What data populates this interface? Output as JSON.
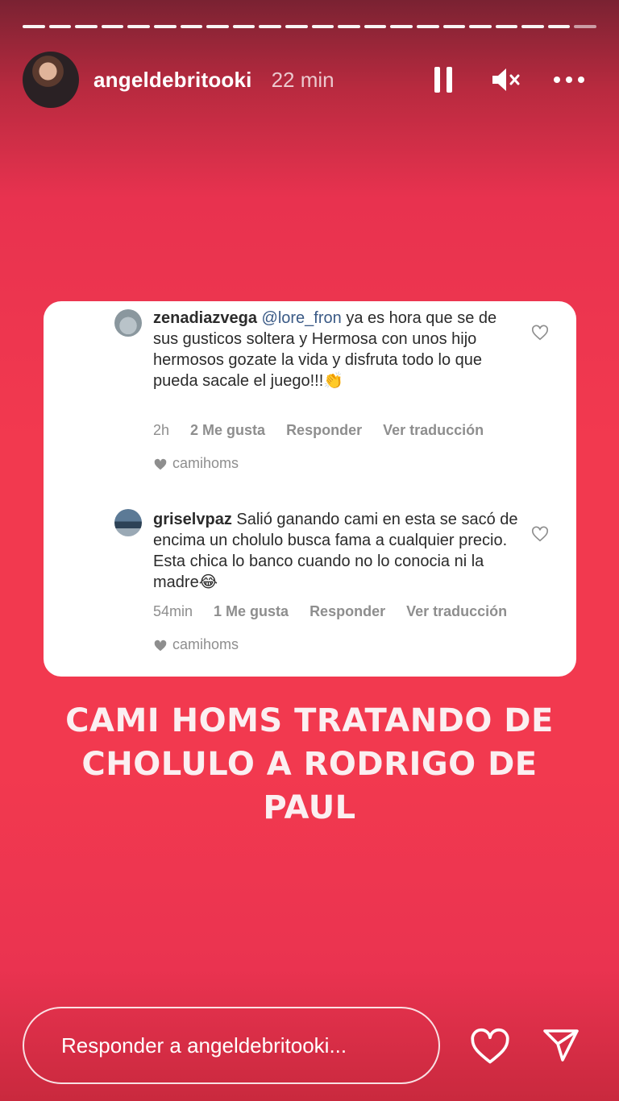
{
  "header": {
    "username": "angeldebritooki",
    "time": "22 min",
    "icons": {
      "pause": "pause-icon",
      "mute": "mute-icon",
      "more": "more-icon"
    }
  },
  "progress_segments": 22,
  "card": {
    "comments": [
      {
        "user": "zenadiazvega",
        "mention": "@lore_fron",
        "text": " ya es hora que se de sus gusticos soltera y Hermosa  con unos hijo hermosos  gozate la vida y disfruta todo lo que pueda sacale  el juego!!!👏",
        "time": "2h",
        "likes": "2 Me gusta",
        "reply": "Responder",
        "translate": "Ver traducción",
        "liked_by": "camihoms"
      },
      {
        "user": "griselvpaz",
        "mention": "",
        "text": " Salió ganando cami en esta se sacó  de encima un cholulo busca fama a cualquier precio. Esta chica lo banco cuando no lo conocia ni la madre😂",
        "time": "54min",
        "likes": "1 Me gusta",
        "reply": "Responder",
        "translate": "Ver traducción",
        "liked_by": "camihoms"
      }
    ]
  },
  "caption": {
    "line1": "CAMI HOMS TRATANDO DE",
    "line2": "CHOLULO A RODRIGO DE PAUL"
  },
  "footer": {
    "reply_placeholder": "Responder a angeldebritooki..."
  },
  "colors": {
    "background": "#f2394f",
    "card": "#ffffff",
    "muted": "#8e8e8e"
  }
}
